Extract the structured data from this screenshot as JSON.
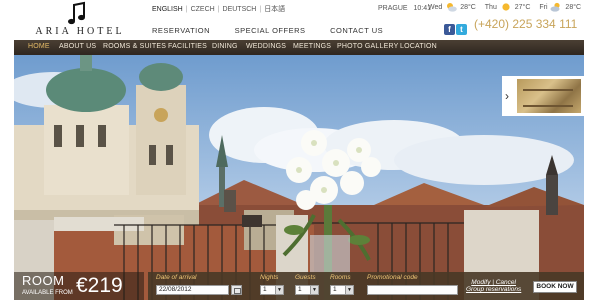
{
  "logo": {
    "text": "ARIA HOTEL",
    "icon": "music-note-icon"
  },
  "languages": [
    {
      "label": "ENGLISH",
      "active": true
    },
    {
      "label": "CZECH",
      "active": false
    },
    {
      "label": "DEUTSCH",
      "active": false
    },
    {
      "label": "日本語",
      "active": false
    }
  ],
  "top_nav": [
    "RESERVATION",
    "SPECIAL OFFERS",
    "CONTACT US"
  ],
  "location": {
    "city": "PRAGUE",
    "time": "10:41"
  },
  "weather": [
    {
      "day": "Wed",
      "temp": "28°C",
      "icon": "partly-cloudy-icon"
    },
    {
      "day": "Thu",
      "temp": "27°C",
      "icon": "sun-icon"
    },
    {
      "day": "Fri",
      "temp": "28°C",
      "icon": "cloud-sun-icon"
    }
  ],
  "social": {
    "facebook": "f",
    "twitter": "t"
  },
  "phone": "(+420) 225 334 111",
  "main_nav": [
    "HOME",
    "ABOUT US",
    "ROOMS & SUITES",
    "FACILITIES",
    "DINING",
    "WEDDINGS",
    "MEETINGS",
    "PHOTO GALLERY",
    "LOCATION"
  ],
  "main_nav_active": "HOME",
  "room_offer": {
    "title": "ROOM",
    "subtitle": "AVAILABLE FROM",
    "price": "€219"
  },
  "booking": {
    "date_label": "Date of arrival",
    "date_value": "22/08/2012",
    "nights_label": "Nights",
    "nights_value": "1",
    "guests_label": "Guests",
    "guests_value": "1",
    "rooms_label": "Rooms",
    "rooms_value": "1",
    "promo_label": "Promotional code",
    "promo_value": "",
    "modify_label": "Modify | Cancel",
    "group_label": "Group reservations",
    "book_label": "BOOK NOW"
  },
  "colors": {
    "nav_bg": "#3b3128",
    "nav_active": "#e5bb67",
    "phone": "#c8a45a",
    "booking_label": "#f0c777"
  }
}
